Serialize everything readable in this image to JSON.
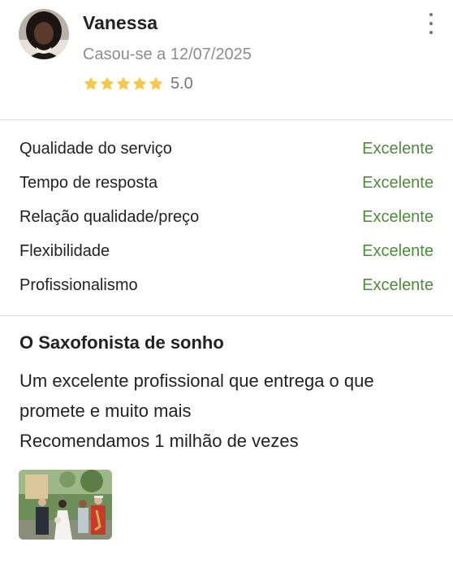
{
  "reviewer": {
    "name": "Vanessa",
    "married_date": "Casou-se a 12/07/2025",
    "rating_value": "5.0",
    "stars_filled": 5,
    "stars_total": 5
  },
  "criteria": [
    {
      "label": "Qualidade do serviço",
      "value": "Excelente"
    },
    {
      "label": "Tempo de resposta",
      "value": "Excelente"
    },
    {
      "label": "Relação qualidade/preço",
      "value": "Excelente"
    },
    {
      "label": "Flexibilidade",
      "value": "Excelente"
    },
    {
      "label": "Profissionalismo",
      "value": "Excelente"
    }
  ],
  "review": {
    "title": "O Saxofonista de sonho",
    "body_lines": [
      "Um excelente profissional que entrega o que promete e muito mais",
      "Recomendamos 1 milhão de vezes"
    ]
  },
  "colors": {
    "star": "#f2c94c",
    "excellent": "#4e8a3d",
    "muted": "#8c8c8c"
  },
  "icons": {
    "more": "vertical-dots-icon",
    "star": "star-icon"
  }
}
